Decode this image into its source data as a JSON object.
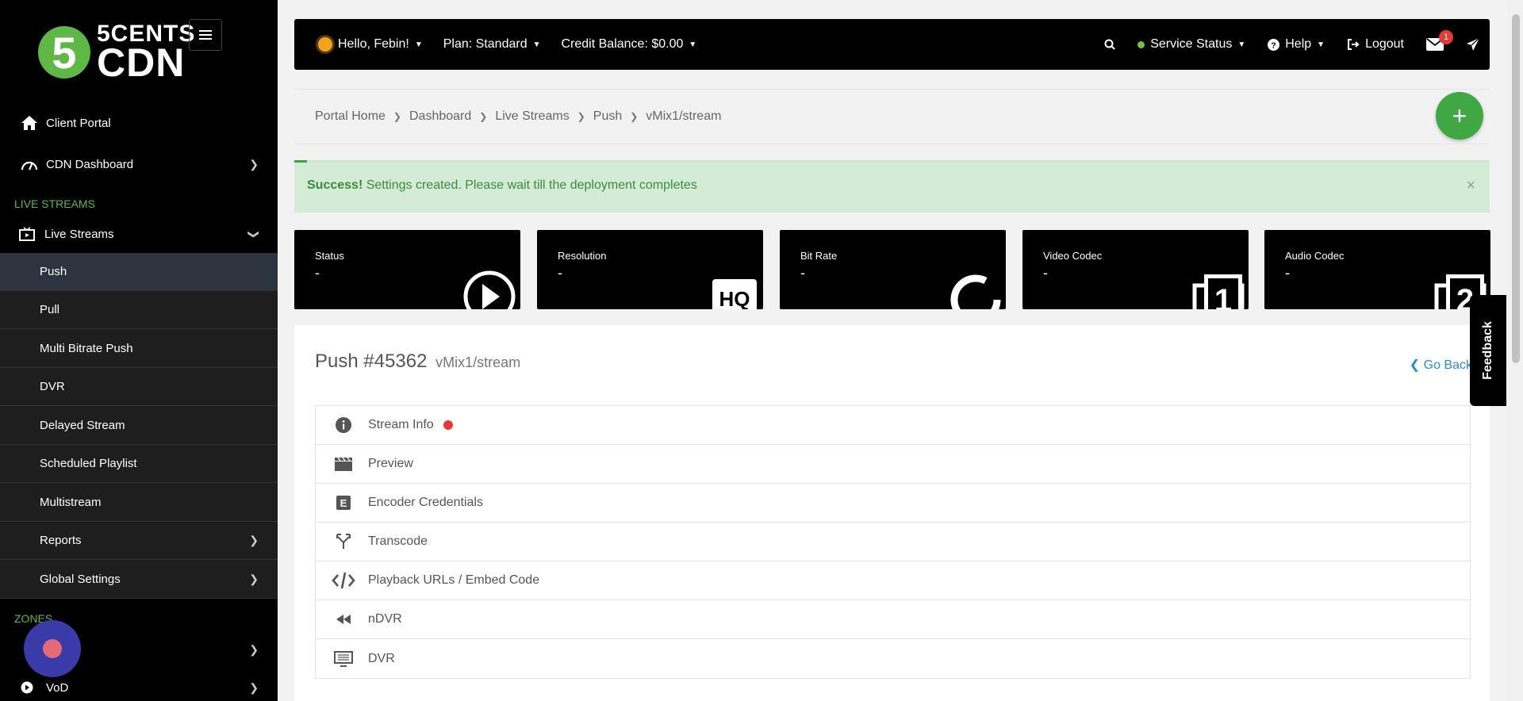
{
  "brand": {
    "logo_digit": "5",
    "line1": "5CENTS",
    "line2": "CDN"
  },
  "sidebar": {
    "top_items": [
      {
        "label": "Client Portal",
        "icon": "home-icon"
      },
      {
        "label": "CDN Dashboard",
        "icon": "speedometer-icon"
      }
    ],
    "section_live": "LIVE STREAMS",
    "live_streams_label": "Live Streams",
    "sub_items": [
      "Push",
      "Pull",
      "Multi Bitrate Push",
      "DVR",
      "Delayed Stream",
      "Scheduled Playlist",
      "Multistream",
      "Reports",
      "Global Settings"
    ],
    "section_zones": "ZONES",
    "vod_label": "VoD"
  },
  "topbar": {
    "greeting": "Hello, Febin!",
    "plan": "Plan: Standard",
    "credit": "Credit Balance: $0.00",
    "service_status": "Service Status",
    "help": "Help",
    "logout": "Logout",
    "messages_count": "1"
  },
  "breadcrumb": [
    "Portal Home",
    "Dashboard",
    "Live Streams",
    "Push",
    "vMix1/stream"
  ],
  "alert": {
    "strong": "Success!",
    "message": " Settings created. Please wait till the deployment completes",
    "close": "×"
  },
  "stats": [
    {
      "label": "Status",
      "value": "-"
    },
    {
      "label": "Resolution",
      "value": "-"
    },
    {
      "label": "Bit Rate",
      "value": "-"
    },
    {
      "label": "Video Codec",
      "value": "-"
    },
    {
      "label": "Audio Codec",
      "value": "-"
    }
  ],
  "panel": {
    "title": "Push #45362",
    "subtitle": "vMix1/stream",
    "go_back": "Go Back",
    "rows": [
      "Stream Info",
      "Preview",
      "Encoder Credentials",
      "Transcode",
      "Playback URLs / Embed Code",
      "nDVR",
      "DVR"
    ]
  },
  "feedback": "Feedback",
  "colors": {
    "accent_green": "#40a843",
    "link_blue": "#2a8bd0",
    "alert_bg": "#d4ecd5"
  }
}
